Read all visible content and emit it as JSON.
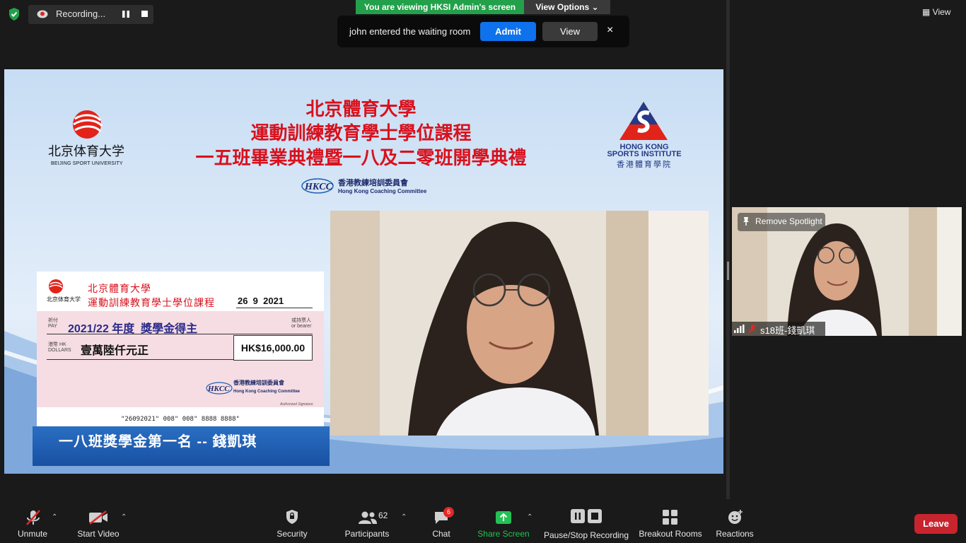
{
  "top_bar": {
    "recording_label": "Recording...",
    "viewing_banner": "You are viewing HKSI Admin's screen",
    "view_options": "View Options",
    "view_label": "View"
  },
  "waiting_room": {
    "message": "john entered the waiting room",
    "admit_label": "Admit",
    "view_label": "View",
    "close_label": "×"
  },
  "shared_screen": {
    "university_cn": "北京体育大学",
    "university_en": "BEIJING SPORT UNIVERSITY",
    "title_lines": [
      "北京體育大學",
      "運動訓練教育學士學位課程",
      "一五班畢業典禮暨一八及二零班開學典禮"
    ],
    "hkcc_cn": "香港教練培訓委員會",
    "hkcc_en": "Hong Kong Coaching Committee",
    "hksi_en_1": "HONG KONG",
    "hksi_en_2": "SPORTS INSTITUTE",
    "hksi_cn": "香港體育學院",
    "cheque": {
      "bsu_small": "北京体育大学",
      "title_1": "北京體育大學",
      "title_2": "運動訓練教育學士學位課程",
      "date": "26  9  2021",
      "pay_label": "祈付 PAY",
      "payee": "2021/22 年度  獎學金得主",
      "bearer_label": "或持票人 or bearer",
      "hk_dollars_label": "港幣 HK DOLLARS",
      "amount_words": "壹萬陸仟元正",
      "amount": "HK$16,000.00",
      "hkcc_cn": "香港教練培訓委員會",
      "hkcc_en": "Hong Kong Coaching Committee",
      "signature_label": "Authorized Signature",
      "micr": "\"26092021\" 008\" 008\" 8888 8888\""
    },
    "caption": "一八班獎學金第一名 -- 錢凱琪"
  },
  "gallery": {
    "remove_spotlight": "Remove Spotlight",
    "participant_name": "s18班-錢凱琪"
  },
  "toolbar": {
    "unmute": "Unmute",
    "start_video": "Start Video",
    "security": "Security",
    "participants": "Participants",
    "participants_count": "62",
    "chat": "Chat",
    "chat_badge": "6",
    "share_screen": "Share Screen",
    "pause_stop_recording": "Pause/Stop Recording",
    "breakout_rooms": "Breakout Rooms",
    "reactions": "Reactions",
    "leave": "Leave"
  },
  "colors": {
    "accent_blue": "#0e72ed",
    "share_green": "#23a04a",
    "leave_red": "#c8242e",
    "title_red": "#d8111d"
  }
}
